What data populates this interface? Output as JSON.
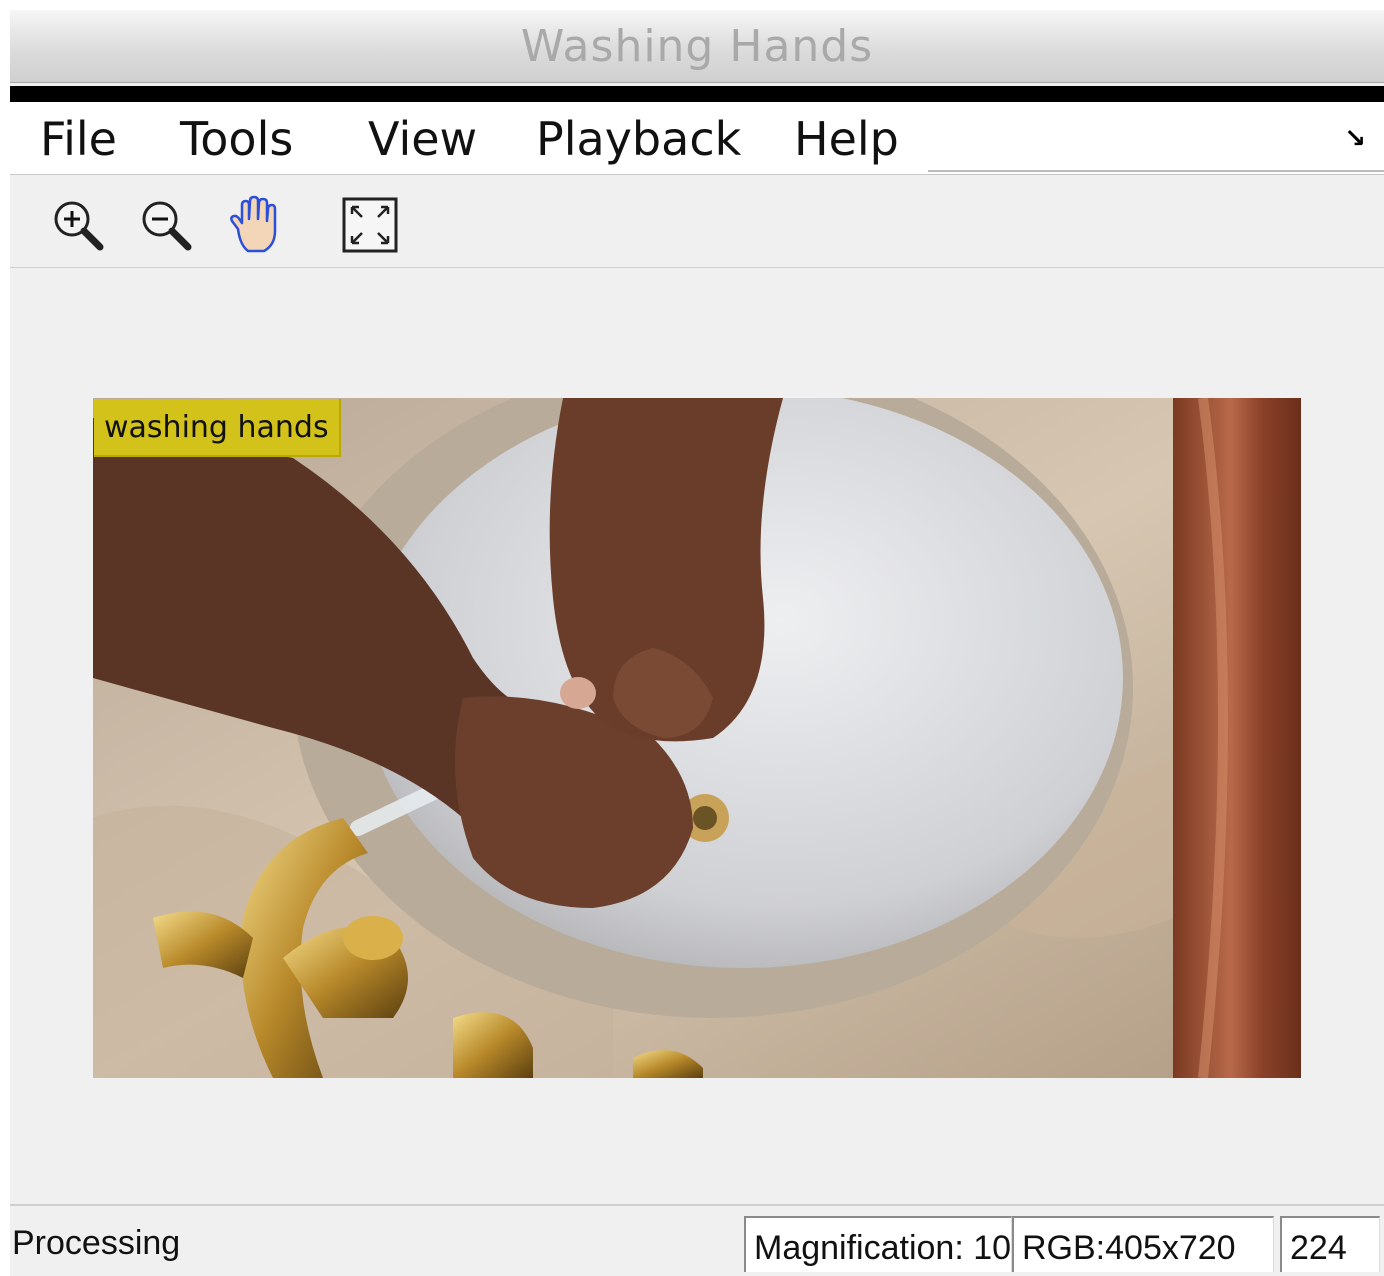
{
  "window": {
    "title": "Washing Hands"
  },
  "menu": {
    "items": [
      "File",
      "Tools",
      "View",
      "Playback",
      "Help"
    ],
    "dock_icon": "undock-arrow-icon"
  },
  "toolbar": {
    "tools": [
      {
        "name": "zoom-in",
        "icon": "zoom-in-icon"
      },
      {
        "name": "zoom-out",
        "icon": "zoom-out-icon"
      },
      {
        "name": "pan",
        "icon": "hand-pan-icon"
      },
      {
        "name": "fit-to-window",
        "icon": "fit-window-icon"
      }
    ]
  },
  "viewer": {
    "label": "washing hands"
  },
  "status": {
    "state": "Processing",
    "magnification": "Magnification: 10",
    "image_info": "RGB:405x720",
    "frame": "224"
  },
  "colors": {
    "label_bg": "#d2c21a",
    "menu_bg": "#ffffff",
    "panel_bg": "#f0f0f0"
  }
}
